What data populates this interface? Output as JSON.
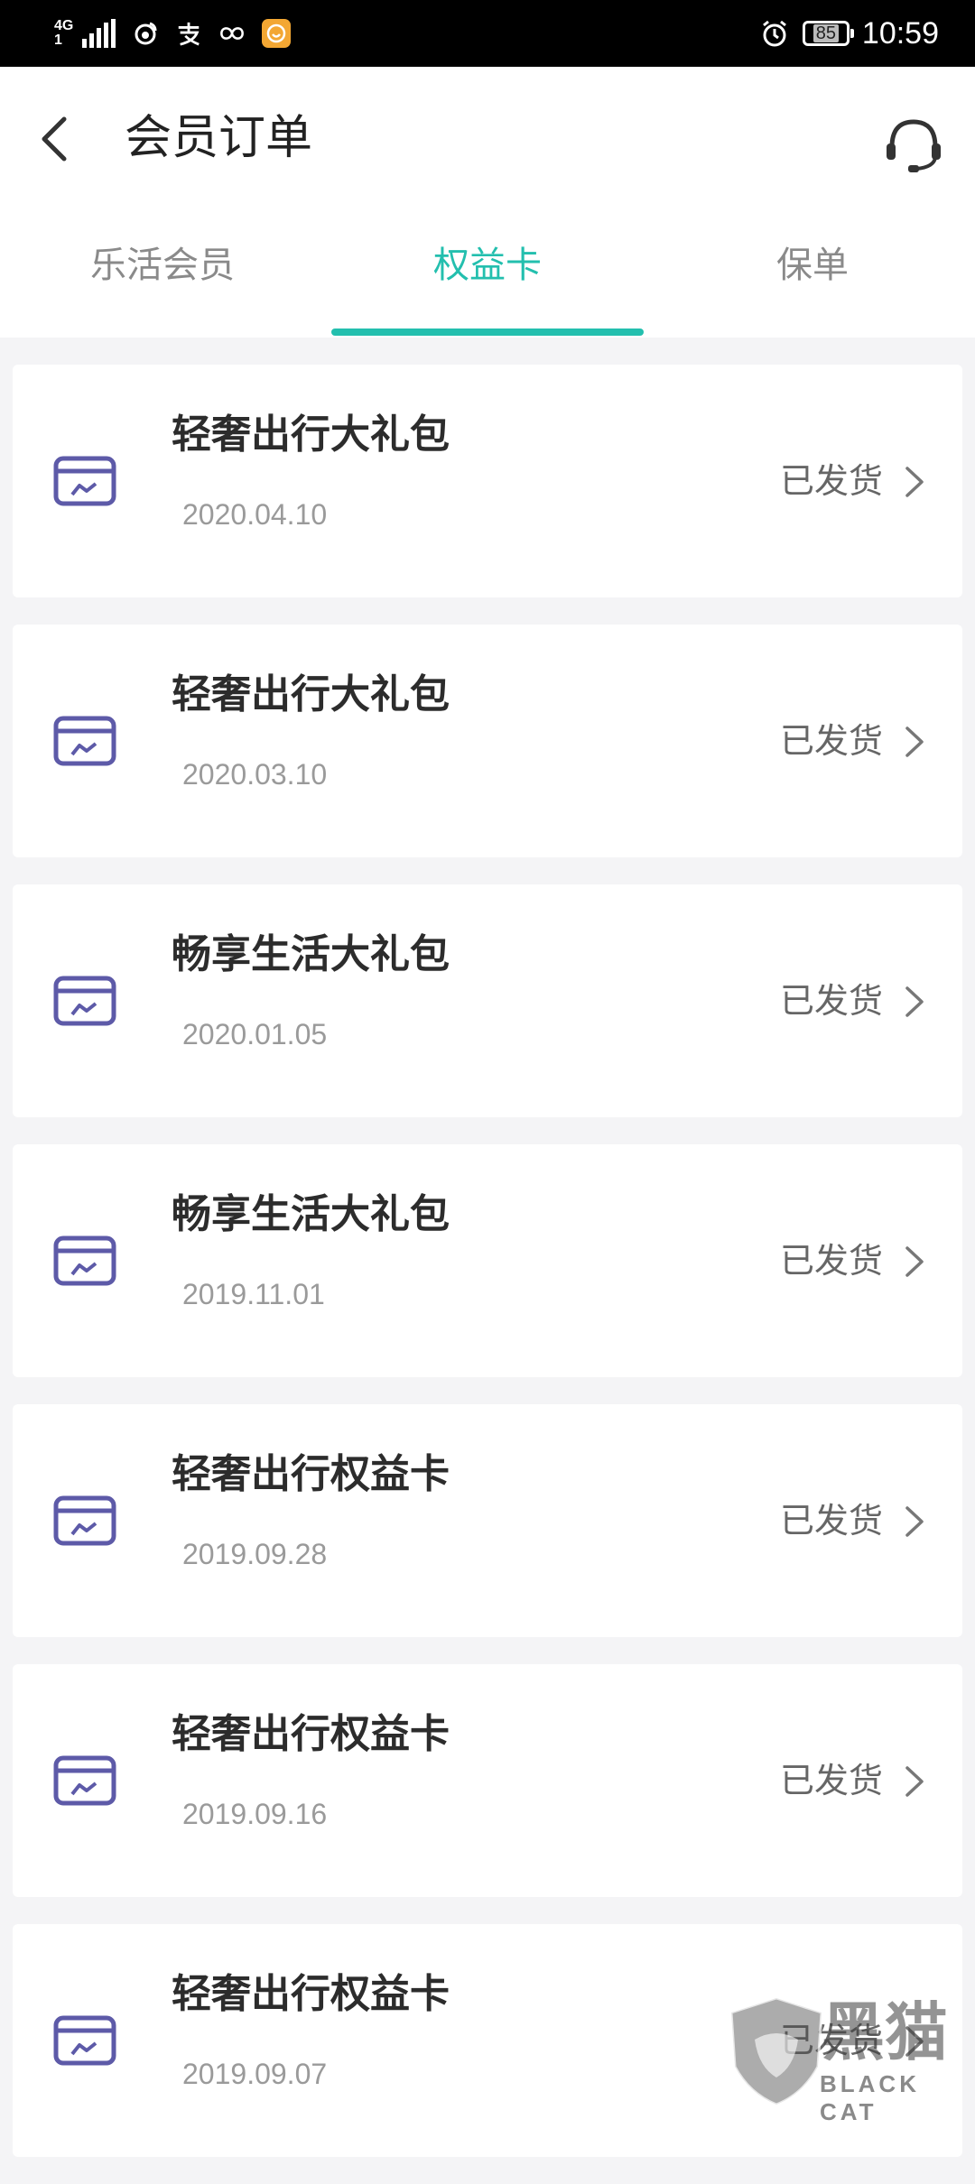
{
  "status_bar": {
    "network": "4G",
    "network_sub": "1",
    "icons": [
      "weibo-icon",
      "alipay-icon",
      "infinity-icon",
      "app-badge-icon"
    ],
    "alarm_icon": "alarm-icon",
    "battery_level": "85",
    "time": "10:59"
  },
  "header": {
    "back_icon": "chevron-left-icon",
    "title": "会员订单",
    "service_icon": "headset-icon"
  },
  "tabs": [
    {
      "label": "乐活会员",
      "active": false
    },
    {
      "label": "权益卡",
      "active": true
    },
    {
      "label": "保单",
      "active": false
    }
  ],
  "accent_color": "#23bfae",
  "icon_color": "#5d5aa8",
  "orders": [
    {
      "title": "轻奢出行大礼包",
      "date": "2020.04.10",
      "status": "已发货"
    },
    {
      "title": "轻奢出行大礼包",
      "date": "2020.03.10",
      "status": "已发货"
    },
    {
      "title": "畅享生活大礼包",
      "date": "2020.01.05",
      "status": "已发货"
    },
    {
      "title": "畅享生活大礼包",
      "date": "2019.11.01",
      "status": "已发货"
    },
    {
      "title": "轻奢出行权益卡",
      "date": "2019.09.28",
      "status": "已发货"
    },
    {
      "title": "轻奢出行权益卡",
      "date": "2019.09.16",
      "status": "已发货"
    },
    {
      "title": "轻奢出行权益卡",
      "date": "2019.09.07",
      "status": "已发货"
    }
  ],
  "watermark": {
    "text": "黑猫",
    "sub": "BLACK CAT"
  }
}
